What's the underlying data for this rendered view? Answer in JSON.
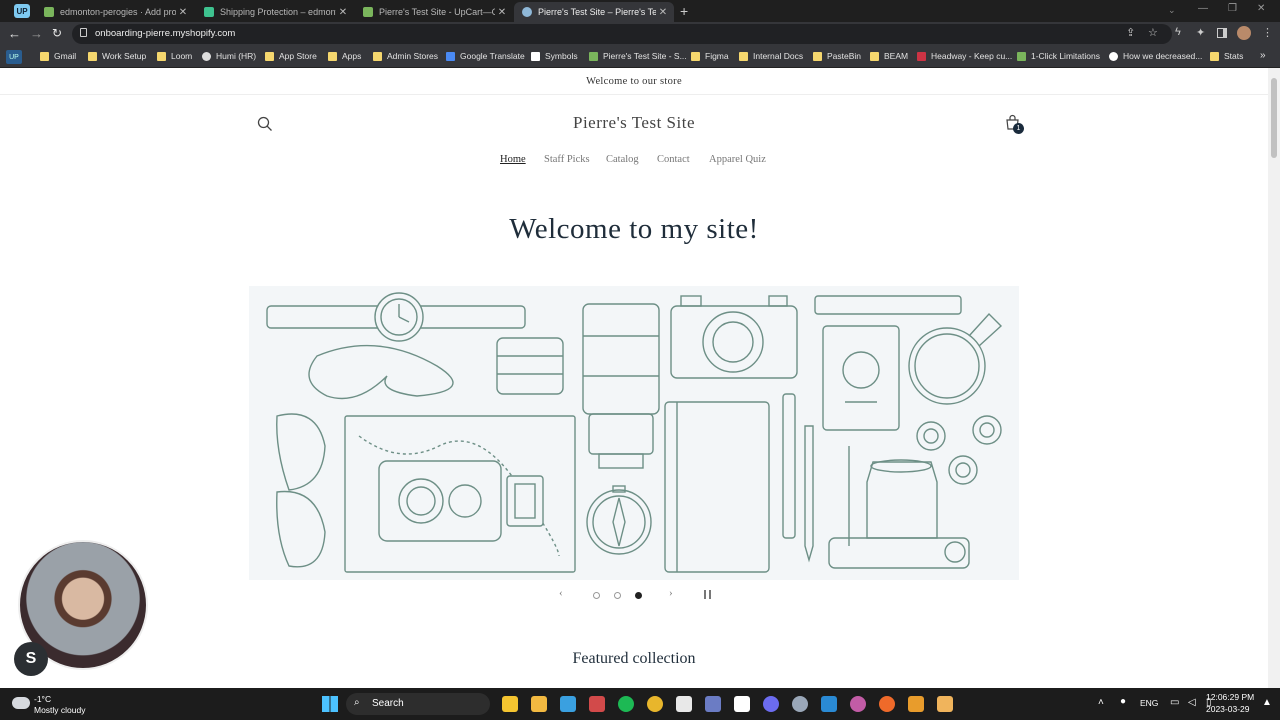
{
  "tabs": [
    {
      "title": "edmonton-perogies · Add produ...",
      "color": "#7ab55c",
      "active": false
    },
    {
      "title": "Shipping Protection – edmonton...",
      "color": "#3ec28f",
      "active": false
    },
    {
      "title": "Pierre's Test Site - UpCart—Cart I...",
      "color": "#7ab55c",
      "active": false
    },
    {
      "title": "Pierre's Test Site – Pierre's Test Si...",
      "color": "#8fb8d8",
      "active": true
    }
  ],
  "profile_badge": "UP",
  "url": "onboarding-pierre.myshopify.com",
  "bookmarks": [
    {
      "label": "Gmail",
      "icon": "folder"
    },
    {
      "label": "Work Setup",
      "icon": "folder"
    },
    {
      "label": "Loom",
      "icon": "folder"
    },
    {
      "label": "Humi (HR)",
      "icon": "globe"
    },
    {
      "label": "App Store",
      "icon": "folder"
    },
    {
      "label": "Apps",
      "icon": "folder"
    },
    {
      "label": "Admin Stores",
      "icon": "folder"
    },
    {
      "label": "Google Translate",
      "icon": "translate"
    },
    {
      "label": "Symbols",
      "icon": "check"
    },
    {
      "label": "Pierre's Test Site - S...",
      "icon": "shopify"
    },
    {
      "label": "Figma",
      "icon": "folder"
    },
    {
      "label": "Internal Docs",
      "icon": "folder"
    },
    {
      "label": "PasteBin",
      "icon": "folder"
    },
    {
      "label": "BEAM",
      "icon": "folder"
    },
    {
      "label": "Headway - Keep cu...",
      "icon": "headway"
    },
    {
      "label": "1-Click Limitations",
      "icon": "shopify"
    },
    {
      "label": "How we decreased...",
      "icon": "dots"
    },
    {
      "label": "Stats",
      "icon": "folder"
    }
  ],
  "store": {
    "announcement": "Welcome to our store",
    "name": "Pierre's Test Site",
    "cart_count": "1",
    "nav": [
      "Home",
      "Staff Picks",
      "Catalog",
      "Contact",
      "Apparel Quiz"
    ],
    "hero_heading": "Welcome to my site!",
    "slideshow": {
      "slides": 3,
      "current": 3
    },
    "featured": "Featured collection"
  },
  "taskbar": {
    "weather_temp": "-1°C",
    "weather_desc": "Mostly cloudy",
    "search": "Search",
    "lang": "ENG",
    "time": "12:06:29 PM",
    "date": "2023-03-29"
  }
}
